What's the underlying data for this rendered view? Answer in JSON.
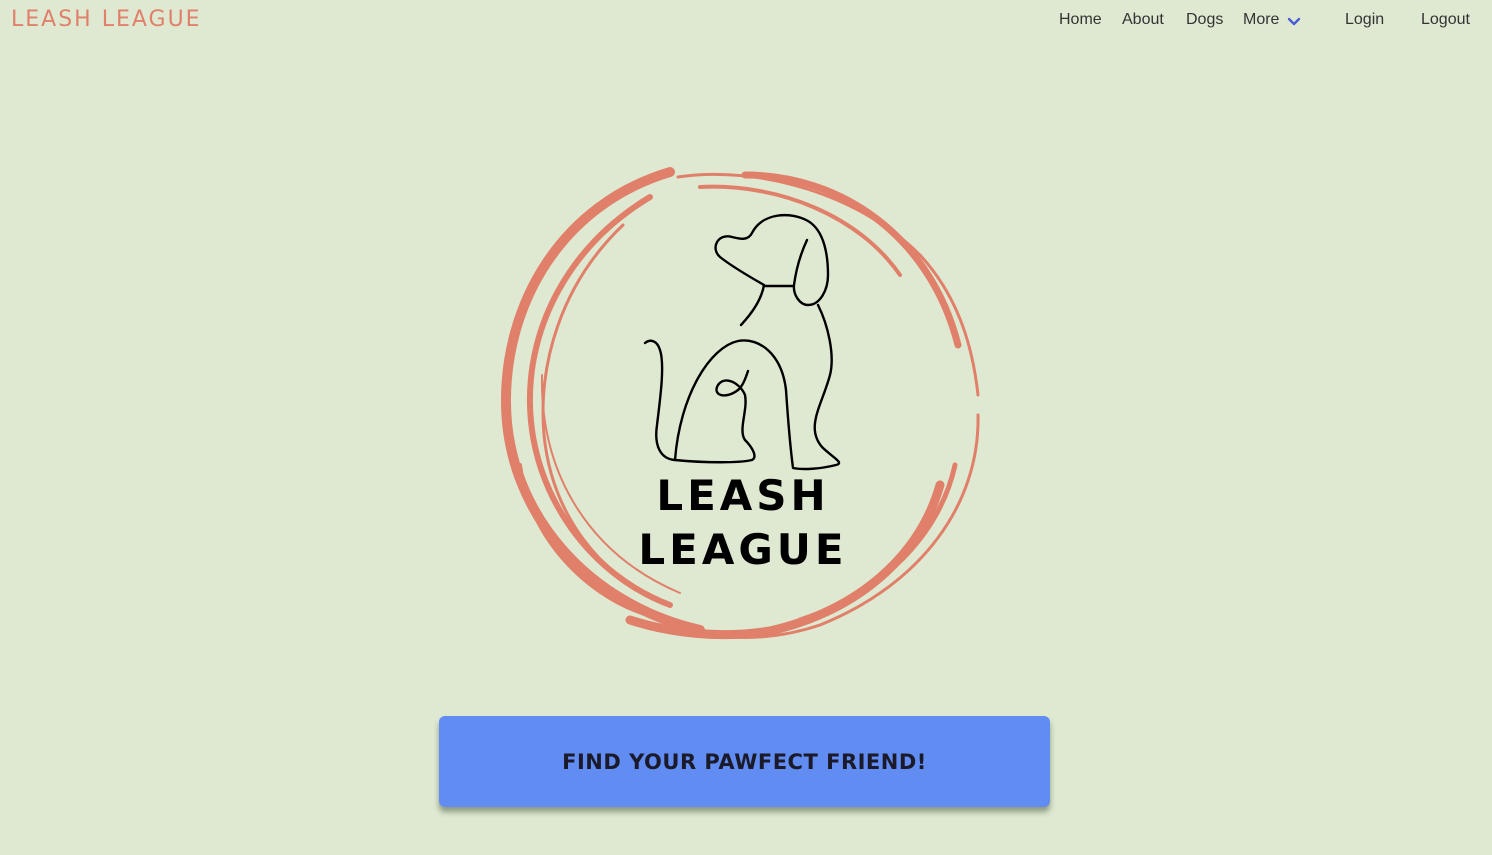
{
  "brand": {
    "name": "LEASH LEAGUE",
    "color": "#e0806a"
  },
  "nav": {
    "items": [
      {
        "label": "Home"
      },
      {
        "label": "About"
      },
      {
        "label": "Dogs"
      },
      {
        "label": "More",
        "icon": "chevron-down-icon",
        "icon_color": "#4a5bd6"
      },
      {
        "label": "Login"
      },
      {
        "label": "Logout"
      }
    ]
  },
  "hero": {
    "logo": {
      "line1": "LEASH",
      "line2": "LEAGUE",
      "ring_color": "#e0806a",
      "icon": "dog-line-art-icon"
    },
    "cta_label": "FIND YOUR PAWFECT FRIEND!",
    "cta_color": "#618cf2"
  },
  "theme": {
    "background": "#dfe9d2"
  }
}
